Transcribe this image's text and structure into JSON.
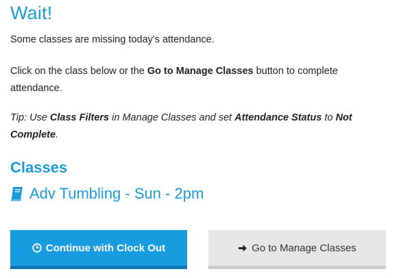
{
  "dialog": {
    "title": "Wait!",
    "message": "Some classes are missing today's attendance.",
    "instruction": {
      "prefix": "Click on the class below or the ",
      "bold": "Go to Manage Classes",
      "suffix": " button to complete attendance."
    },
    "tip": {
      "part1": "Tip: Use ",
      "bold1": "Class Filters",
      "part2": " in Manage Classes and set ",
      "bold2": "Attendance Status",
      "part3": " to ",
      "bold3": "Not Complete",
      "part4": "."
    }
  },
  "classes": {
    "heading": "Classes",
    "items": [
      {
        "label": "Adv Tumbling - Sun - 2pm",
        "icon": "book-icon"
      }
    ]
  },
  "buttons": {
    "continue": {
      "label": "Continue with Clock Out",
      "icon": "clock-icon"
    },
    "manage": {
      "label": "Go to Manage Classes",
      "icon": "arrow-right-icon"
    }
  },
  "colors": {
    "accent": "#1a9bd7",
    "primary_button": "#179ce0",
    "secondary_button": "#e6e6e6"
  }
}
